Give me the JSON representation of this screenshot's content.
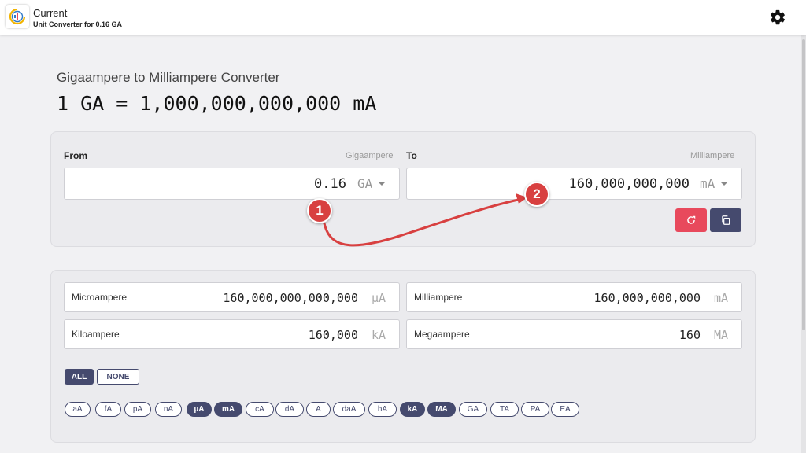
{
  "header": {
    "app_name": "Current",
    "subtitle": "Unit Converter for 0.16 GA",
    "settings_icon": "gear-icon"
  },
  "converter": {
    "title": "Gigaampere to Milliampere Converter",
    "formula": "1 GA = 1,000,000,000,000 mA"
  },
  "from": {
    "label": "From",
    "unit_name": "Gigaampere",
    "value": "0.16",
    "unit_symbol": "GA"
  },
  "to": {
    "label": "To",
    "unit_name": "Milliampere",
    "value": "160,000,000,000",
    "unit_symbol": "mA"
  },
  "actions": {
    "reset_icon": "refresh-icon",
    "copy_icon": "copy-icon",
    "reset_color": "#e8495c",
    "copy_color": "#454a6e"
  },
  "results": [
    {
      "name": "Microampere",
      "value": "160,000,000,000,000",
      "unit": "µA"
    },
    {
      "name": "Milliampere",
      "value": "160,000,000,000",
      "unit": "mA"
    },
    {
      "name": "Kiloampere",
      "value": "160,000",
      "unit": "kA"
    },
    {
      "name": "Megaampere",
      "value": "160",
      "unit": "MA"
    }
  ],
  "toggles": {
    "all": "ALL",
    "none": "NONE"
  },
  "chips": [
    {
      "label": "aA",
      "selected": false
    },
    {
      "label": "fA",
      "selected": false
    },
    {
      "label": "pA",
      "selected": false
    },
    {
      "label": "nA",
      "selected": false
    },
    {
      "label": "µA",
      "selected": true
    },
    {
      "label": "mA",
      "selected": true
    },
    {
      "label": "cA",
      "selected": false
    },
    {
      "label": "dA",
      "selected": false
    },
    {
      "label": "A",
      "selected": false
    },
    {
      "label": "daA",
      "selected": false
    },
    {
      "label": "hA",
      "selected": false
    },
    {
      "label": "kA",
      "selected": true
    },
    {
      "label": "MA",
      "selected": true
    },
    {
      "label": "GA",
      "selected": false
    },
    {
      "label": "TA",
      "selected": false
    },
    {
      "label": "PA",
      "selected": false
    },
    {
      "label": "EA",
      "selected": false
    }
  ],
  "annotations": {
    "step1": "1",
    "step2": "2",
    "color": "#d84040"
  },
  "colors": {
    "accent": "#454a6e",
    "danger": "#e8495c",
    "background": "#f1f1f3"
  }
}
